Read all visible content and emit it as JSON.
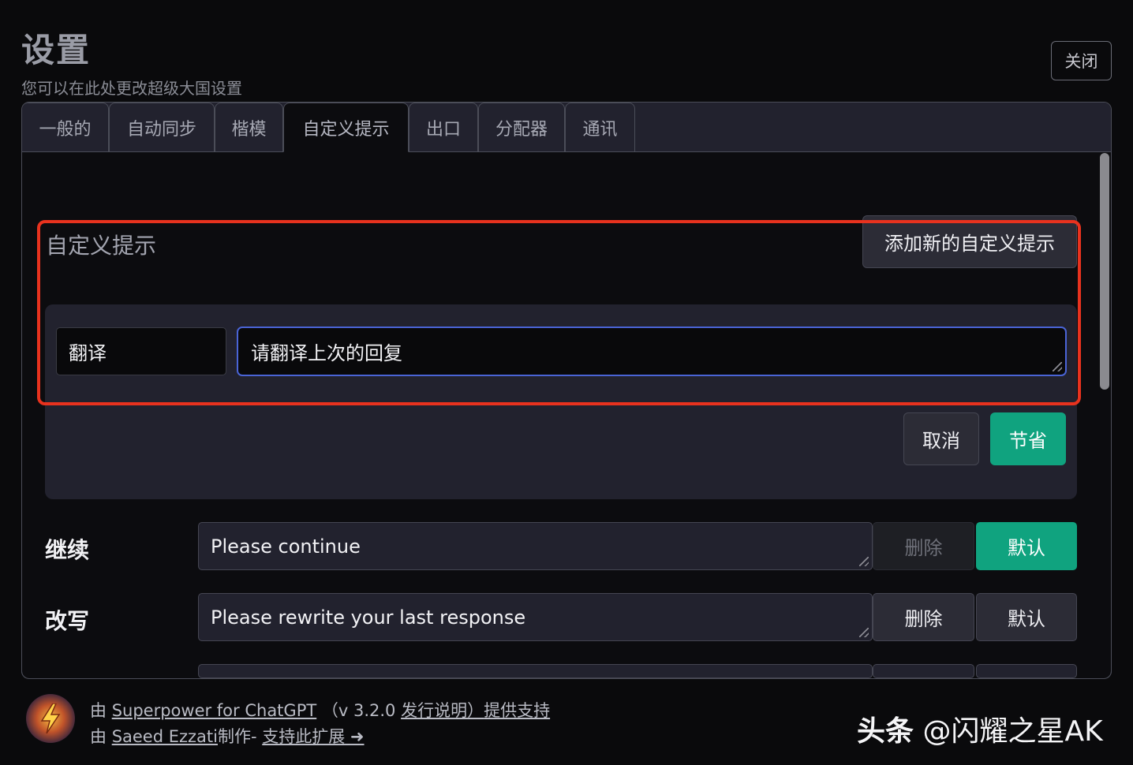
{
  "header": {
    "title": "设置",
    "subtitle": "您可以在此处更改超级大国设置",
    "close_label": "关闭"
  },
  "tabs": [
    {
      "label": "一般的"
    },
    {
      "label": "自动同步"
    },
    {
      "label": "楷模"
    },
    {
      "label": "自定义提示"
    },
    {
      "label": "出口"
    },
    {
      "label": "分配器"
    },
    {
      "label": "通讯"
    }
  ],
  "active_tab": "自定义提示",
  "custom_prompts": {
    "section_title": "自定义提示",
    "add_button": "添加新的自定义提示",
    "editor": {
      "name_value": "翻译",
      "prompt_value": "请翻译上次的回复",
      "cancel_label": "取消",
      "save_label": "节省"
    },
    "rows": [
      {
        "label": "继续",
        "text": "Please continue",
        "delete_label": "删除",
        "default_label": "默认",
        "delete_disabled": true,
        "default_active": true
      },
      {
        "label": "改写",
        "text": "Please rewrite your last response",
        "delete_label": "删除",
        "default_label": "默认",
        "delete_disabled": false,
        "default_active": false
      }
    ]
  },
  "footer": {
    "line1_prefix": "由",
    "line1_link": "Superpower for ChatGPT",
    "line1_version": "（v 3.2.0",
    "line1_notes_link": "发行说明）",
    "line1_support_link": "提供支持",
    "line2_prefix": "由",
    "line2_author_link": "Saeed Ezzati",
    "line2_made": "制作-",
    "line2_support_link": "支持此扩展 ➜"
  },
  "watermark": {
    "brand": "头条",
    "handle": "@闪耀之星AK"
  },
  "colors": {
    "accent_green": "#10a37f",
    "focus_blue": "#4a64d6",
    "highlight_red": "#e8321e"
  }
}
